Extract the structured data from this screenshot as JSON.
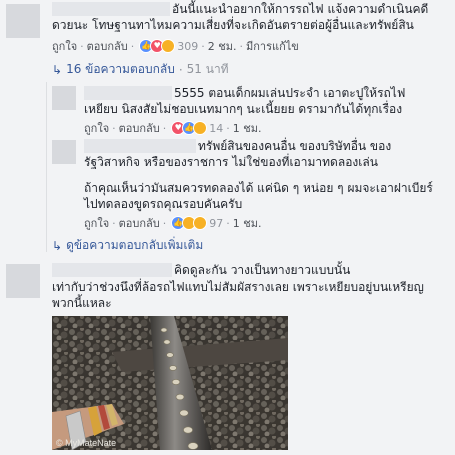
{
  "comments": [
    {
      "line1": "อันนี้แนะนำอยากให้การรถไฟ แจ้งความดำเนินคดี",
      "line2": "ดวยนะ โทษฐานทาไหมความเสี่ยงที่จะเกิดอันตรายต่อผู้อื่นและทรัพย์สิน",
      "like": "ถูกใจ",
      "reply": "ตอบกลับ",
      "count": "309",
      "time": "2 ชม.",
      "edited": "มีการแก้ไข"
    },
    {
      "line1": "5555 ตอนเด็กผมเล่นประจำ เอาตะปูให้รถไฟ",
      "line2": "เหยียบ นิสงสัยไม่ชอบเนทมากๆ นะเนี้ยยย ดรามากันได้ทุกเรื่อง",
      "like": "ถูกใจ",
      "reply": "ตอบกลับ",
      "count": "14",
      "time": "1 ชม."
    },
    {
      "line1": "ทรัพย์สินของคนอื่น ของบริษัทอื่น ของ",
      "line2": "รัฐวิสาหกิจ หรือของราชการ ไม่ใช่ของที่เอามาทดลองเล่น",
      "line3": "ถ้าคุณเห็นว่ามันสมควรทดลองได้ แค่นิด ๆ หน่อย ๆ ผมจะเอาฝาเบียร์",
      "line4": "ไปทดลองขูดรถคุณรอบคันครับ",
      "like": "ถูกใจ",
      "reply": "ตอบกลับ",
      "count": "97",
      "time": "1 ชม."
    },
    {
      "line1": "คิดดูละกัน วางเป็นทางยาวแบบนั้น",
      "line2": "เท่ากับว่าช่วงนึงที่ล้อรถไฟแทบไม่สัมผัสรางเลย เพราะเหยียบอยู่บนเหรียญ",
      "line3": "พวกนี้แหละ",
      "watermark": "© MyMateNate"
    }
  ],
  "replies_a": {
    "text": "16 ข้อความตอบกลับ",
    "time": "51 นาที"
  },
  "replies_b": {
    "text": "ดูข้อความตอบกลับเพิ่มเติม"
  },
  "separator": "·",
  "colors": {
    "link": "#365899",
    "muted": "#90949c",
    "text": "#1d2129",
    "bg": "#f2f3f5"
  }
}
